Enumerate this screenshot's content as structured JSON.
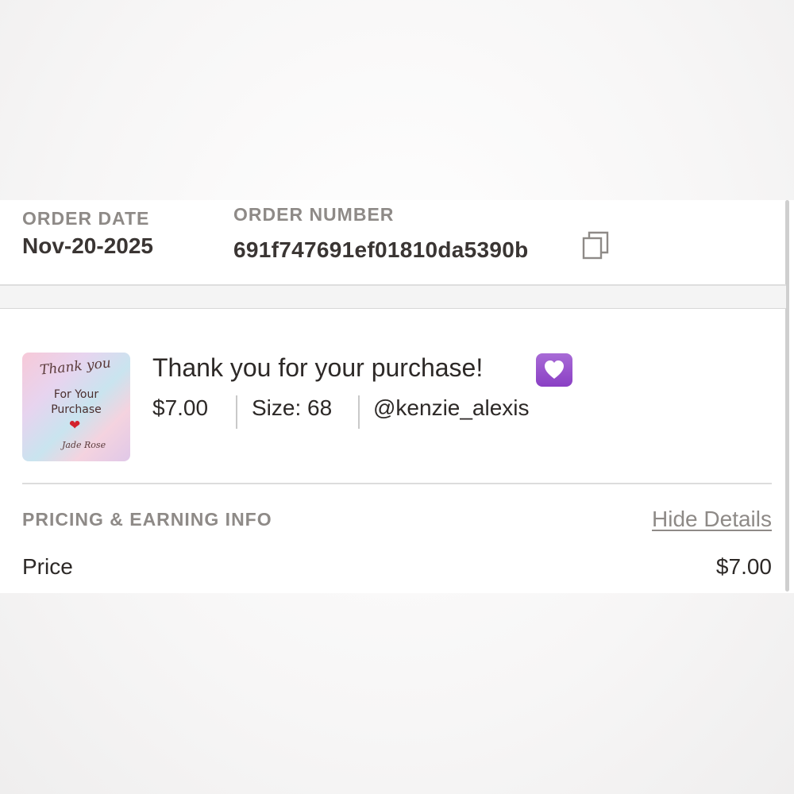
{
  "order": {
    "date_label": "ORDER DATE",
    "date_value": "Nov-20-2025",
    "number_label": "ORDER NUMBER",
    "number_value": "691f747691ef01810da5390b",
    "copy_icon": "copy-icon"
  },
  "item": {
    "thumbnail": {
      "line1": "Thank you",
      "line2": "For Your",
      "line3": "Purchase",
      "signature": "Jade Rose"
    },
    "title": "Thank you for your purchase!",
    "title_emoji": "purple-heart-icon",
    "price": "$7.00",
    "size": "Size: 68",
    "seller": "@kenzie_alexis"
  },
  "pricing": {
    "section_label": "PRICING & EARNING INFO",
    "toggle_label": "Hide Details",
    "rows": [
      {
        "label": "Price",
        "value": "$7.00"
      }
    ]
  },
  "colors": {
    "label_gray": "#8e8a87",
    "text_dark": "#2d2927",
    "emoji_purple": "#8a3fc4"
  }
}
